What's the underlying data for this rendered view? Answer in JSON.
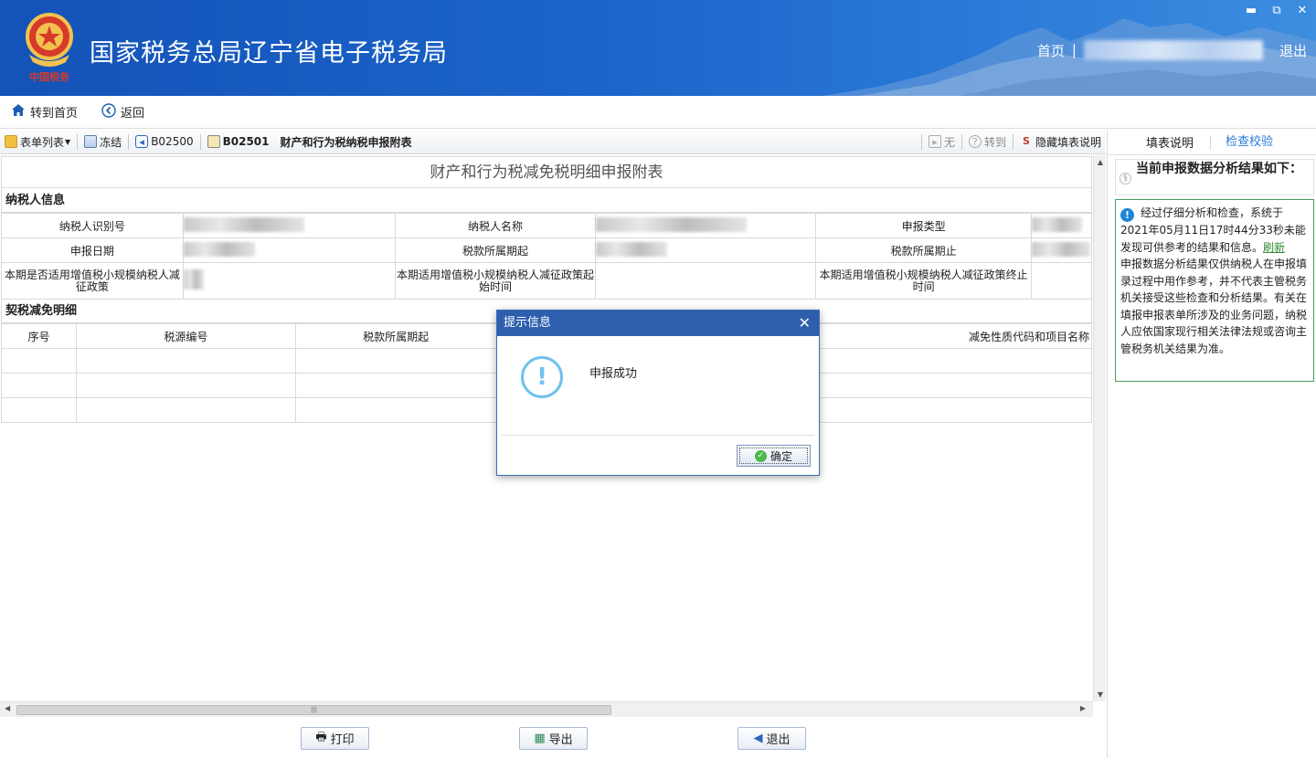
{
  "header": {
    "app_title": "国家税务总局辽宁省电子税务局",
    "emblem_text": "中国税务",
    "nav": {
      "home": "首页",
      "separator": "|",
      "logout": "退出"
    },
    "window_controls": {
      "minimize": "▬",
      "restore": "⧉",
      "close": "✕"
    }
  },
  "navbar": {
    "home": "转到首页",
    "back": "返回"
  },
  "toolbar": {
    "form_list": "表单列表",
    "freeze": "冻结",
    "prev_form": "B02500",
    "current_code": "B02501",
    "current_name": "财产和行为税纳税申报附表",
    "none": "无",
    "goto": "转到",
    "hide_help": "隐藏填表说明"
  },
  "form": {
    "title": "财产和行为税减免税明细申报附表",
    "taxpayer_section": "纳税人信息",
    "labels": {
      "taxpayer_id": "纳税人识别号",
      "taxpayer_name": "纳税人名称",
      "declare_type": "申报类型",
      "declare_date": "申报日期",
      "period_start": "税款所属期起",
      "period_end": "税款所属期止",
      "small_scale": "本期是否适用增值税小规模纳税人减征政策",
      "policy_start": "本期适用增值税小规模纳税人减征政策起始时间",
      "policy_end": "本期适用增值税小规模纳税人减征政策终止时间"
    },
    "deed_section": "契税减免明细",
    "columns": [
      "序号",
      "税源编号",
      "税款所属期起",
      "减免性质代码和项目名称"
    ]
  },
  "bottom_buttons": {
    "print": "打印",
    "export": "导出",
    "exit": "退出"
  },
  "right_panel": {
    "tabs": [
      "填表说明",
      "检查校验"
    ],
    "active_tab": "检查校验",
    "heading": "当前申报数据分析结果如下：",
    "result_text": "经过仔细分析和检查，系统于2021年05月11日17时44分33秒未能发现可供参考的结果和信息。",
    "refresh": "刷新",
    "disclaimer": "申报数据分析结果仅供纳税人在申报填录过程中用作参考，并不代表主管税务机关接受这些检查和分析结果。有关在填报申报表单所涉及的业务问题，纳税人应依国家现行相关法律法规或咨询主管税务机关结果为准。"
  },
  "modal": {
    "title": "提示信息",
    "message": "申报成功",
    "ok": "确定",
    "close": "✕"
  },
  "colors": {
    "header": "#1b64c9",
    "modal_title": "#2e5fae",
    "accent": "#2a7ad8",
    "check_box_border": "#4a9b5c"
  }
}
